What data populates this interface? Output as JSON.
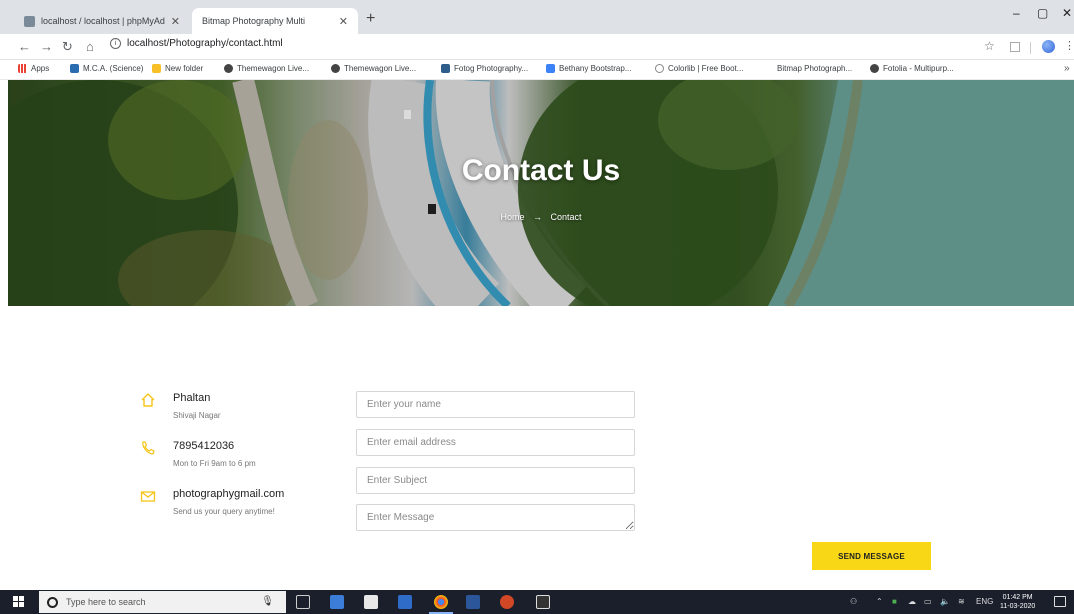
{
  "browser": {
    "tabs": [
      {
        "label": "localhost / localhost | phpMyAdmin",
        "active": false
      },
      {
        "label": "Bitmap Photography Multi",
        "active": true
      }
    ],
    "new_tab": "+",
    "url": "localhost/Photography/contact.html",
    "bookmarks": [
      {
        "label": "Apps",
        "color": "#ea4335"
      },
      {
        "label": "M.C.A. (Science)",
        "color": "#2b6cb0"
      },
      {
        "label": "New folder",
        "color": "#f6c026"
      },
      {
        "label": "Themewagon Live...",
        "color": "#444444"
      },
      {
        "label": "Themewagon Live...",
        "color": "#444444"
      },
      {
        "label": "Fotog Photography...",
        "color": "#2f5d8a"
      },
      {
        "label": "Bethany Bootstrap...",
        "color": "#3b82f6"
      },
      {
        "label": "Colorlib | Free Boot...",
        "color": "#888888"
      },
      {
        "label": "Bitmap Photograph...",
        "color": "#ffffff"
      },
      {
        "label": "Fotolia - Multipurp...",
        "color": "#444444"
      }
    ]
  },
  "hero": {
    "title": "Contact Us",
    "breadcrumb": {
      "home": "Home",
      "separator": "→",
      "current": "Contact"
    }
  },
  "contact_info": [
    {
      "icon": "home-icon",
      "main": "Phaltan",
      "sub": "Shivaji Nagar"
    },
    {
      "icon": "phone-icon",
      "main": "7895412036",
      "sub": "Mon to Fri 9am to 6 pm"
    },
    {
      "icon": "mail-icon",
      "main": "photographygmail.com",
      "sub": "Send us your query anytime!"
    }
  ],
  "form": {
    "name_placeholder": "Enter your name",
    "email_placeholder": "Enter email address",
    "subject_placeholder": "Enter Subject",
    "message_placeholder": "Enter Message",
    "submit_label": "SEND MESSAGE"
  },
  "taskbar": {
    "search_placeholder": "Type here to search",
    "language": "ENG",
    "time": "01:42 PM",
    "date": "11-03-2020"
  },
  "colors": {
    "accent": "#f7d716",
    "icon_accent": "#f5c518"
  }
}
